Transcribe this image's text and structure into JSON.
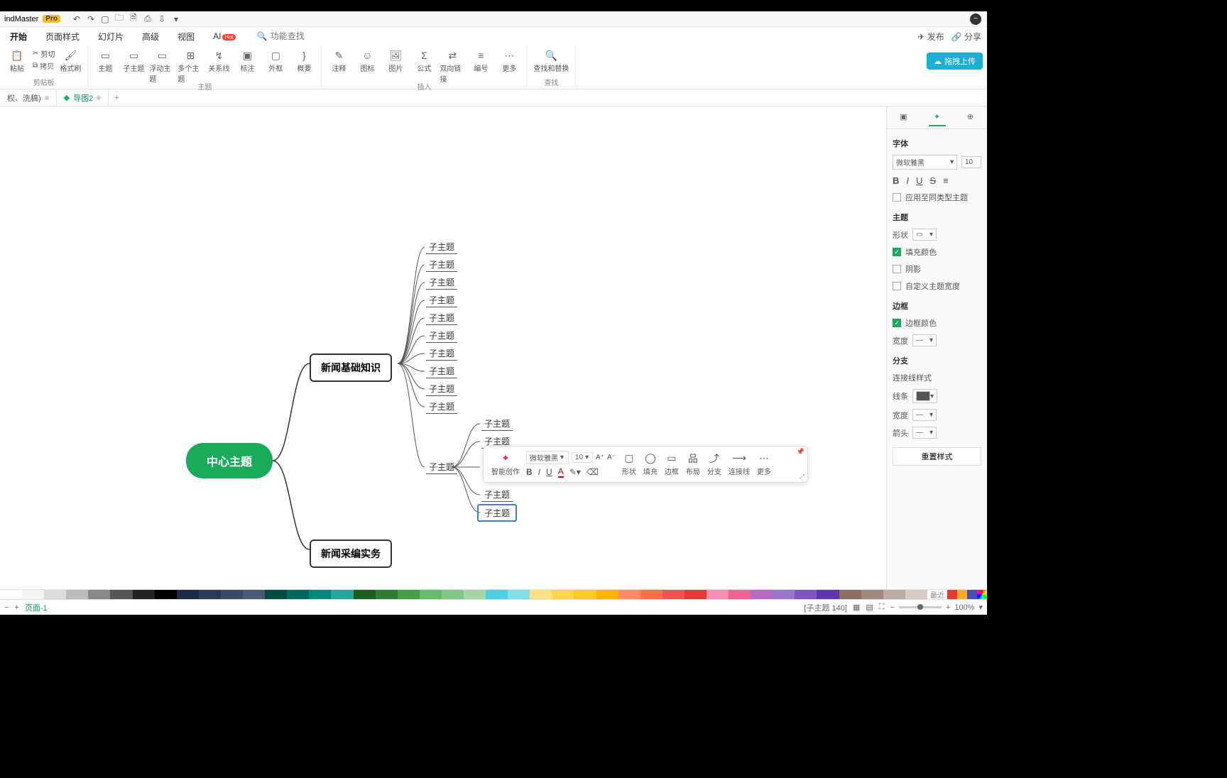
{
  "title": {
    "brand": "indMaster",
    "pro": "Pro"
  },
  "menu": {
    "tabs": [
      "开始",
      "页面样式",
      "幻灯片",
      "高级",
      "视图",
      "AI"
    ],
    "hot": "Hot",
    "search_ph": "功能查找",
    "publish": "发布",
    "share": "分享"
  },
  "ribbon": {
    "g1": {
      "paste": "粘贴",
      "cut": "剪切",
      "copy": "拷贝",
      "brush": "格式刷",
      "label": "剪贴板"
    },
    "g2": {
      "items": [
        "主题",
        "子主题",
        "浮动主题",
        "多个主题",
        "关系线",
        "标注",
        "外框",
        "概要"
      ],
      "label": "主题"
    },
    "g3": {
      "items": [
        "注释",
        "图标",
        "图片",
        "公式",
        "双向链接",
        "编号",
        "更多"
      ],
      "label": "插入"
    },
    "g4": {
      "item": "查找和替换",
      "label": "查找"
    },
    "upload": "拖拽上传"
  },
  "doctabs": {
    "t1": "权、洗稿)",
    "t2": "导图2"
  },
  "map": {
    "central": "中心主题",
    "main1": "新闻基础知识",
    "main2": "新闻采编实务",
    "sub": "子主题",
    "subsel": "子主题"
  },
  "floatbar": {
    "ai": "智能创作",
    "font": "微软雅黑",
    "size": "10",
    "shape": "形状",
    "fill": "填充",
    "border": "边框",
    "layout": "布局",
    "branch": "分支",
    "connector": "连接线",
    "more": "更多"
  },
  "panel": {
    "h_font": "字体",
    "font": "微软雅黑",
    "size": "10",
    "apply": "应用至同类型主题",
    "h_topic": "主题",
    "shape": "形状",
    "fill": "填充颜色",
    "shadow": "阴影",
    "custw": "自定义主题宽度",
    "h_border": "边框",
    "bcolor": "边框颜色",
    "bwidth": "宽度",
    "h_branch": "分支",
    "connstyle": "连接线样式",
    "line": "线条",
    "lwidth": "宽度",
    "arrow": "箭头",
    "reset": "重置样式"
  },
  "colorstrip": {
    "recent": "最近"
  },
  "status": {
    "page": "页面-1",
    "sel": "[子主题 140]",
    "zoom": "100%"
  }
}
